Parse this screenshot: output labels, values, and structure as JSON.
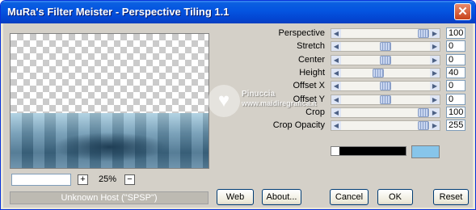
{
  "window": {
    "title": "MuRa's Filter Meister - Perspective Tiling 1.1",
    "close_glyph": "✕"
  },
  "controls": [
    {
      "name": "Perspective",
      "value": "100",
      "level": 1.0
    },
    {
      "name": "Stretch",
      "value": "0",
      "level": 0.5
    },
    {
      "name": "Center",
      "value": "0",
      "level": 0.5
    },
    {
      "name": "Height",
      "value": "40",
      "level": 0.4
    },
    {
      "name": "Offset X",
      "value": "0",
      "level": 0.5
    },
    {
      "name": "Offset Y",
      "value": "0",
      "level": 0.5
    },
    {
      "name": "Crop",
      "value": "100",
      "level": 1.0
    },
    {
      "name": "Crop Opacity",
      "value": "255",
      "level": 1.0
    }
  ],
  "colors": {
    "swatch_bar": "#000000",
    "swatch_small": "#ffffff",
    "swatch_big": "#87c5ea"
  },
  "zoom": {
    "minus_label": "+",
    "plus_label": "−",
    "value": "25%"
  },
  "status_text": "Unknown Host (\"SPSP\")",
  "buttons": {
    "web": "Web",
    "about": "About...",
    "cancel": "Cancel",
    "ok": "OK",
    "reset": "Reset"
  },
  "watermark": {
    "name": "Pinuccia",
    "site": "www.maidiregrafica.it"
  }
}
